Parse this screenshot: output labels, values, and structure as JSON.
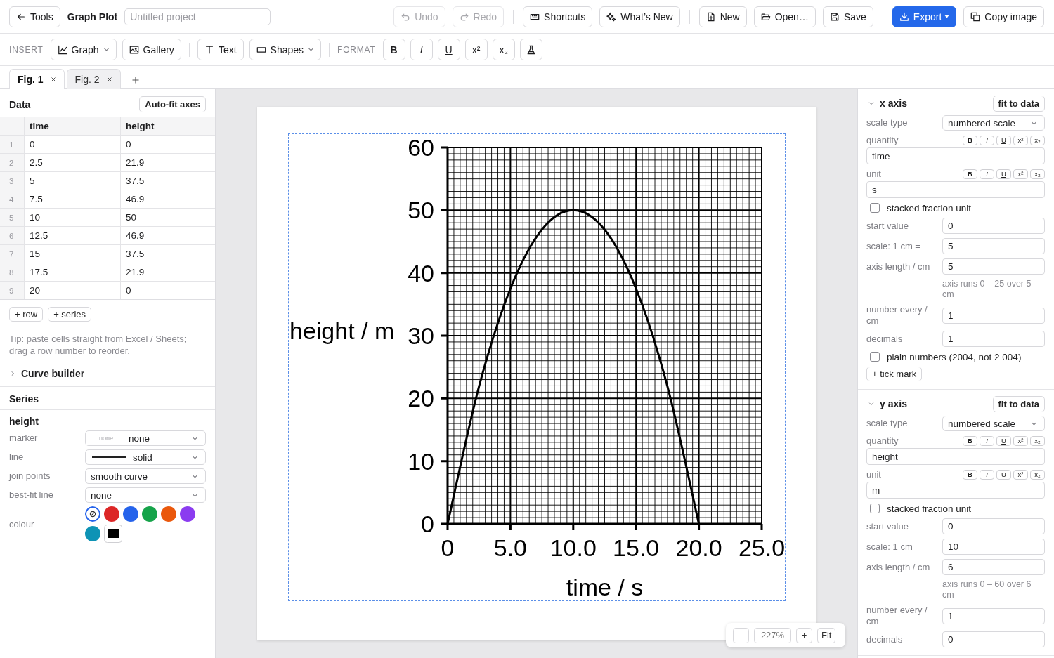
{
  "top_bar": {
    "back_button": "Tools",
    "app_title": "Graph Plot",
    "project_name": {
      "placeholder": "Untitled project"
    },
    "undo": {
      "label": "Undo",
      "disabled": true
    },
    "redo": {
      "label": "Redo",
      "disabled": true
    },
    "shortcuts": "Shortcuts",
    "whats_new": "What’s New",
    "new": "New",
    "open": "Open…",
    "save": "Save",
    "export": "Export",
    "copy_image": "Copy image"
  },
  "insert_bar": {
    "insert_label": "INSERT",
    "graph": "Graph",
    "gallery": "Gallery",
    "text": "Text",
    "shapes": "Shapes",
    "format_label": "FORMAT",
    "format_buttons": [
      "B",
      "I",
      "U",
      "x²",
      "x₂"
    ]
  },
  "tabs": [
    {
      "label": "Fig. 1",
      "selected": true
    },
    {
      "label": "Fig. 2",
      "selected": false
    }
  ],
  "data_panel": {
    "title": "Data",
    "autofit_button": "Auto-fit axes",
    "table": {
      "columns": [
        "time",
        "height"
      ],
      "rows": [
        {
          "number": "1",
          "cells": [
            "0",
            "0"
          ]
        },
        {
          "number": "2",
          "cells": [
            "2.5",
            "21.9"
          ]
        },
        {
          "number": "3",
          "cells": [
            "5",
            "37.5"
          ]
        },
        {
          "number": "4",
          "cells": [
            "7.5",
            "46.9"
          ]
        },
        {
          "number": "5",
          "cells": [
            "10",
            "50"
          ]
        },
        {
          "number": "6",
          "cells": [
            "12.5",
            "46.9"
          ]
        },
        {
          "number": "7",
          "cells": [
            "15",
            "37.5"
          ]
        },
        {
          "number": "8",
          "cells": [
            "17.5",
            "21.9"
          ]
        },
        {
          "number": "9",
          "cells": [
            "20",
            "0"
          ]
        }
      ]
    },
    "add_buttons": [
      "+ row",
      "+ series"
    ],
    "tip": "Tip: paste cells straight from Excel / Sheets; drag a row number to reorder.",
    "curve_builder": {
      "label": "Curve builder",
      "expanded": false
    }
  },
  "series_panel": {
    "title": "Series",
    "series": [
      {
        "name": "height",
        "fields": [
          {
            "kind": "marker-select",
            "label": "marker",
            "preview": "none",
            "value": "none"
          },
          {
            "kind": "line-select",
            "label": "line",
            "value": "solid"
          },
          {
            "kind": "select",
            "label": "join points",
            "value": "smooth curve"
          },
          {
            "kind": "select",
            "label": "best-fit line",
            "value": "none"
          }
        ],
        "colour": {
          "label": "colour",
          "swatches": [
            {
              "kind": "auto",
              "selected": true
            },
            {
              "kind": "swatch",
              "color": "#dc2626",
              "selected": false
            },
            {
              "kind": "swatch",
              "color": "#2563eb",
              "selected": false
            },
            {
              "kind": "swatch",
              "color": "#16a34a",
              "selected": false
            },
            {
              "kind": "swatch",
              "color": "#ea580c",
              "selected": false
            },
            {
              "kind": "swatch",
              "color": "#8b3cf0",
              "selected": false
            },
            {
              "kind": "swatch",
              "color": "#0e93b5",
              "selected": false
            },
            {
              "kind": "custom",
              "color": "#000000",
              "selected": false
            }
          ]
        }
      }
    ]
  },
  "canvas": {
    "figure": {
      "selected": true,
      "chart_data": {
        "type": "line",
        "xlabel": "time / s",
        "ylabel": "height / m",
        "x": [
          0,
          2.5,
          5,
          7.5,
          10,
          12.5,
          15,
          17.5,
          20
        ],
        "series": [
          {
            "color": "#000000",
            "values": [
              0,
              21.9,
              37.5,
              46.9,
              50,
              46.9,
              37.5,
              21.9,
              0
            ]
          }
        ],
        "xlim": [
          0,
          25
        ],
        "ylim": [
          0,
          60
        ],
        "xticks": [
          0,
          {
            "value": 5,
            "label": "5.0"
          },
          {
            "value": 10,
            "label": "10.0"
          },
          {
            "value": 15,
            "label": "15.0"
          },
          {
            "value": 20,
            "label": "20.0"
          },
          {
            "value": 25,
            "label": "25.0"
          }
        ],
        "yticks": [
          0,
          10,
          20,
          30,
          40,
          50,
          60
        ],
        "grid": true
      }
    },
    "zoom": {
      "out": "–",
      "level": "227%",
      "in": "+",
      "fit": "Fit"
    }
  },
  "axes": [
    {
      "title": "x axis",
      "expanded": true,
      "fit_button": "fit to data",
      "rows": [
        {
          "kind": "select",
          "label": "scale type",
          "value": "numbered scale"
        },
        {
          "kind": "rich-input",
          "label": "quantity",
          "format": [
            "B",
            "I",
            "U",
            "x²",
            "x₂"
          ],
          "value": "time"
        },
        {
          "kind": "rich-input",
          "label": "unit",
          "format": [
            "B",
            "I",
            "U",
            "x²",
            "x₂"
          ],
          "value": "s"
        },
        {
          "kind": "checkbox",
          "label": "stacked fraction unit",
          "checked": false
        },
        {
          "kind": "input",
          "label": "start value",
          "value": "0"
        },
        {
          "kind": "input",
          "label": "scale: 1 cm =",
          "value": "5"
        },
        {
          "kind": "input",
          "label": "axis length / cm",
          "value": "5"
        },
        {
          "kind": "hint",
          "text": "axis runs 0 – 25 over 5 cm"
        },
        {
          "kind": "input",
          "label": "number every / cm",
          "value": "1"
        },
        {
          "kind": "input",
          "label": "decimals",
          "value": "1"
        },
        {
          "kind": "checkbox",
          "label": "plain numbers (2004, not 2 004)",
          "checked": false
        },
        {
          "kind": "button",
          "label": "+ tick mark"
        }
      ]
    },
    {
      "title": "y axis",
      "expanded": true,
      "fit_button": "fit to data",
      "rows": [
        {
          "kind": "select",
          "label": "scale type",
          "value": "numbered scale"
        },
        {
          "kind": "rich-input",
          "label": "quantity",
          "format": [
            "B",
            "I",
            "U",
            "x²",
            "x₂"
          ],
          "value": "height"
        },
        {
          "kind": "rich-input",
          "label": "unit",
          "format": [
            "B",
            "I",
            "U",
            "x²",
            "x₂"
          ],
          "value": "m"
        },
        {
          "kind": "checkbox",
          "label": "stacked fraction unit",
          "checked": false
        },
        {
          "kind": "input",
          "label": "start value",
          "value": "0"
        },
        {
          "kind": "input",
          "label": "scale: 1 cm =",
          "value": "10"
        },
        {
          "kind": "input",
          "label": "axis length / cm",
          "value": "6"
        },
        {
          "kind": "hint",
          "text": "axis runs 0 – 60 over 6 cm"
        },
        {
          "kind": "input",
          "label": "number every / cm",
          "value": "1"
        },
        {
          "kind": "input",
          "label": "decimals",
          "value": "0"
        }
      ]
    }
  ]
}
